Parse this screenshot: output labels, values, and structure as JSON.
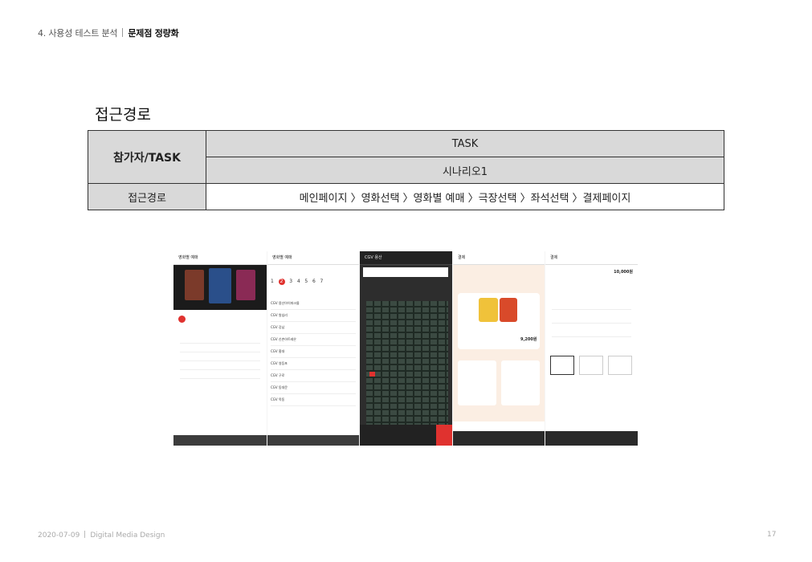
{
  "header": {
    "section": "4. 사용성 테스트 분석",
    "subsection": "문제점 정량화"
  },
  "section_title": "접근경로",
  "table": {
    "participant_header": "참가자/TASK",
    "task_header": "TASK",
    "scenario": "시나리오1",
    "path_label": "접근경로",
    "path_value": "메인페이지 〉영화선택 〉영화별 예매 〉극장선택 〉좌석선택 〉결제페이지"
  },
  "screens": {
    "s1_title": "영화별 예매",
    "s2_title": "영화별 예매",
    "s3_title": "CGV 용산",
    "s4_title": "결제",
    "s5_title": "결제",
    "s2_dates": [
      "1",
      "2",
      "3",
      "4",
      "5",
      "6",
      "7"
    ],
    "s2_theaters": [
      "CGV 용산아이파크몰",
      "CGV 왕십리",
      "CGV 강남",
      "CGV 신촌아트레온",
      "CGV 홍대",
      "CGV 영등포",
      "CGV 구로",
      "CGV 동대문",
      "CGV 목동"
    ],
    "s5_price": "10,000원",
    "s4_price": "9,200원"
  },
  "footer": {
    "date": "2020-07-09",
    "org": "Digital Media Design",
    "page": "17"
  },
  "colors": {
    "table_grey": "#d9d9d9",
    "accent_red": "#e0322f",
    "seat_dark": "#1f2a24"
  }
}
